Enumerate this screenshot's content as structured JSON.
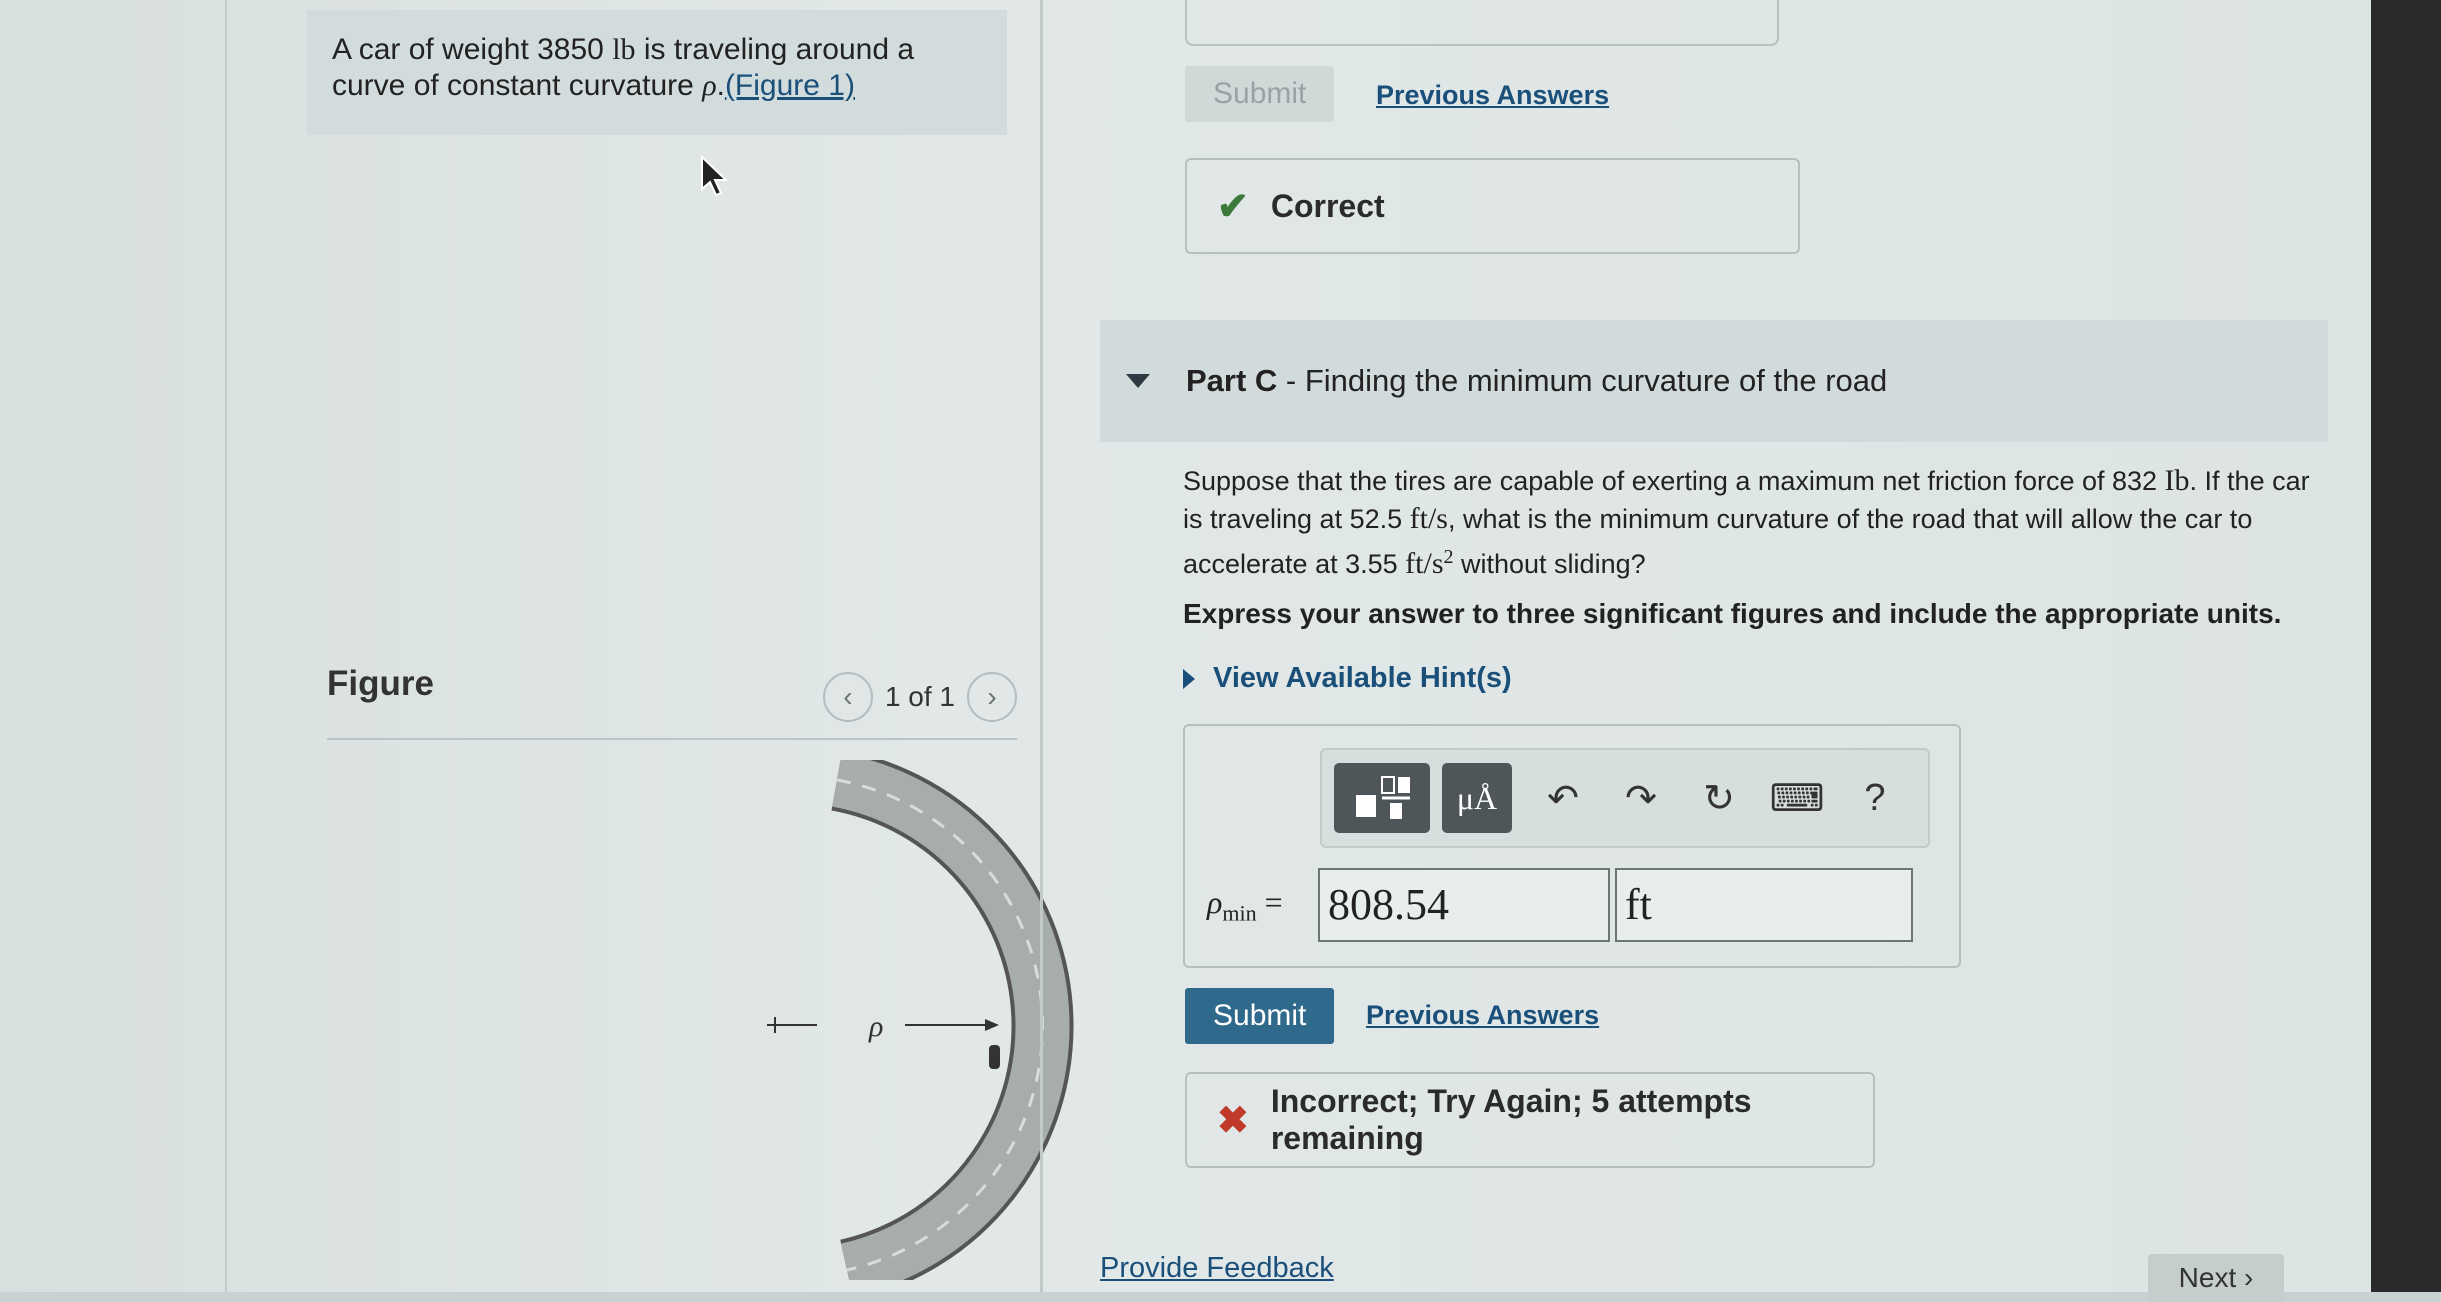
{
  "intro": {
    "text_before": "A car of weight 3850",
    "weight_unit": "lb",
    "text_middle": " is traveling around a curve of constant curvature ",
    "rho": "ρ",
    "figure_link": "(Figure 1)"
  },
  "figure": {
    "title": "Figure",
    "pager": "1 of 1",
    "prev_icon": "chevron-left-icon",
    "next_icon": "chevron-right-icon",
    "rho_label": "ρ"
  },
  "part_b": {
    "submit_label": "Submit",
    "previous_answers": "Previous Answers",
    "feedback": "Correct"
  },
  "part_c": {
    "label": "Part C",
    "title": " - Finding the minimum curvature of the road",
    "question_1": "Suppose that the tires are capable of exerting a maximum net friction force of 832 ",
    "force_unit": "Ib",
    "question_2": ". If the car is traveling at 52.5 ",
    "speed_unit": "ft/s",
    "question_3": ", what is the minimum curvature of the road that will allow the car to accelerate at 3.55 ",
    "accel_unit": "ft/s",
    "accel_exp": "2",
    "question_4": " without sliding?",
    "instructions": "Express your answer to three significant figures and include the appropriate units.",
    "hint_label": "View Available Hint(s)",
    "toolbar": {
      "templates_icon": "templates-icon",
      "units_label": "μÅ",
      "undo_icon": "undo-icon",
      "redo_icon": "redo-icon",
      "reset_icon": "reset-icon",
      "keyboard_icon": "keyboard-icon",
      "help_label": "?"
    },
    "answer_label": "ρ",
    "answer_sub": "min",
    "answer_eq": "=",
    "answer_value": "808.54",
    "answer_unit": "ft",
    "submit_label": "Submit",
    "previous_answers": "Previous Answers",
    "feedback": "Incorrect; Try Again; 5 attempts remaining"
  },
  "footer": {
    "provide_feedback": "Provide Feedback",
    "next_label": "Next"
  }
}
